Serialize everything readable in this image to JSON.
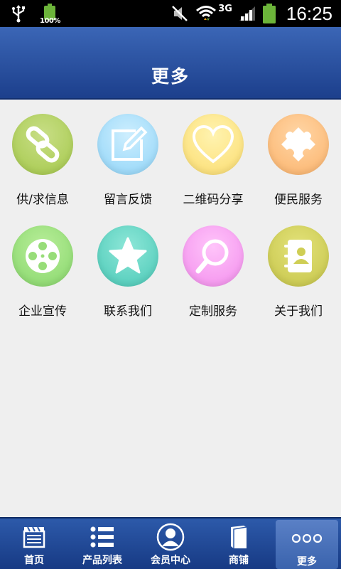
{
  "status_bar": {
    "battery_small_label": "100%",
    "network_label": "3G",
    "time": "16:25"
  },
  "header": {
    "title": "更多"
  },
  "grid": {
    "items": [
      {
        "label": "供/求信息",
        "icon": "link-icon",
        "color": "#b5d36a"
      },
      {
        "label": "留言反馈",
        "icon": "edit-icon",
        "color": "#b3e3fb"
      },
      {
        "label": "二维码分享",
        "icon": "heart-icon",
        "color": "#fde89a"
      },
      {
        "label": "便民服务",
        "icon": "puzzle-icon",
        "color": "#fcc58a"
      },
      {
        "label": "企业宣传",
        "icon": "film-reel-icon",
        "color": "#a2e283"
      },
      {
        "label": "联系我们",
        "icon": "star-icon",
        "color": "#6fd6c8"
      },
      {
        "label": "定制服务",
        "icon": "magnifier-icon",
        "color": "#f9a9f4"
      },
      {
        "label": "关于我们",
        "icon": "contacts-book-icon",
        "color": "#d6d563"
      }
    ]
  },
  "tabbar": {
    "tabs": [
      {
        "label": "首页",
        "icon": "clapper-icon"
      },
      {
        "label": "产品列表",
        "icon": "list-icon"
      },
      {
        "label": "会员中心",
        "icon": "user-icon"
      },
      {
        "label": "商铺",
        "icon": "book-icon"
      },
      {
        "label": "更多",
        "icon": "more-dots-icon"
      }
    ],
    "active_index": 4
  }
}
